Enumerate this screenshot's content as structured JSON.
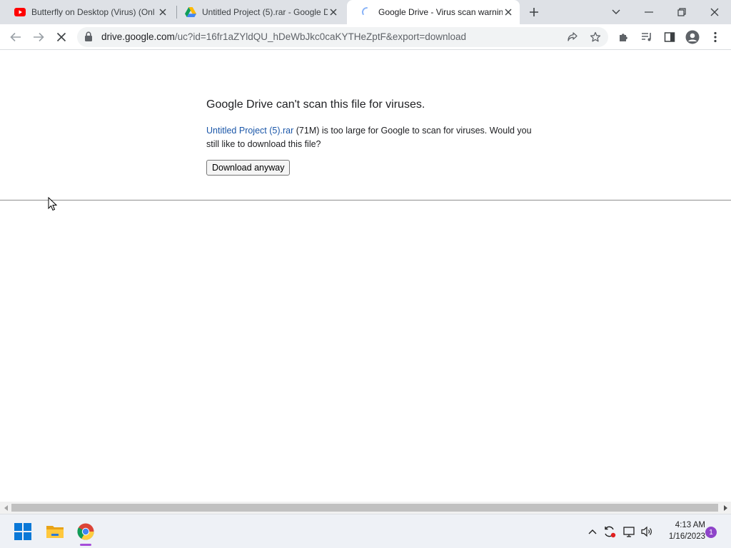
{
  "browser": {
    "tabs": [
      {
        "title": "Butterfly on Desktop (Virus) (Onl",
        "icon": "youtube-icon"
      },
      {
        "title": "Untitled Project (5).rar - Google D",
        "icon": "google-drive-icon"
      },
      {
        "title": "Google Drive - Virus scan warnin",
        "icon": "loading-spinner-icon"
      }
    ],
    "url_host": "drive.google.com",
    "url_path": "/uc?id=16fr1aZYldQU_hDeWbJkc0caKYTHeZptF&export=download"
  },
  "page": {
    "heading": "Google Drive can't scan this file for viruses.",
    "file_name": "Untitled Project (5).rar",
    "file_size": "(71M)",
    "message_rest": " is too large for Google to scan for viruses. Would you still like to download this file?",
    "download_button": "Download anyway"
  },
  "taskbar": {
    "time": "4:13 AM",
    "date": "1/16/2023",
    "notification_count": "1"
  },
  "colors": {
    "link": "#1a56a8",
    "tabstrip": "#dee1e6",
    "chrome_indicator": "#a64dd9"
  }
}
